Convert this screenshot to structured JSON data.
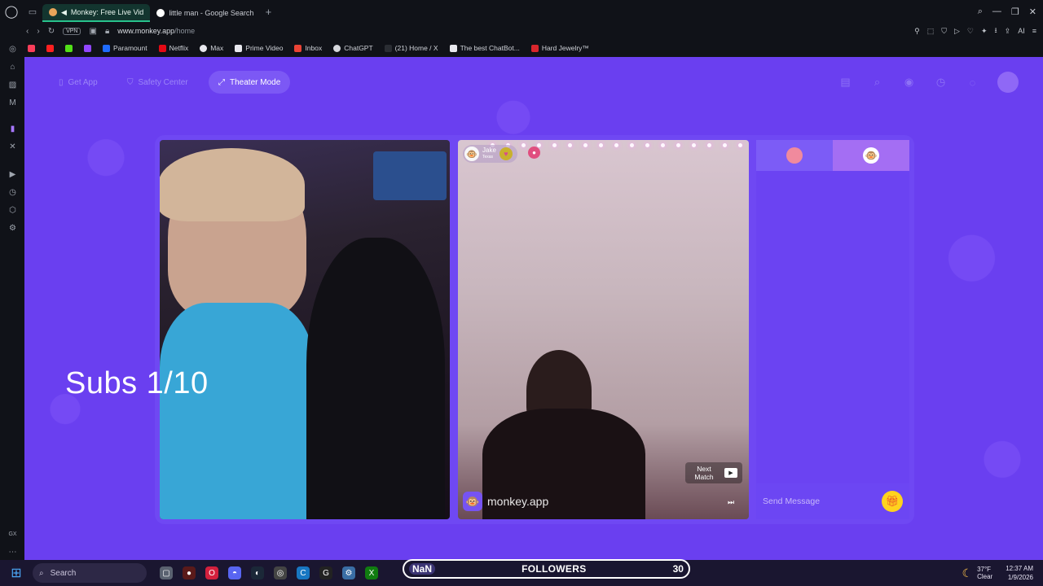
{
  "browser": {
    "tabs": [
      {
        "title": "Monkey: Free Live Vid",
        "active": true
      },
      {
        "title": "little man - Google Search",
        "active": false
      }
    ],
    "address": {
      "vpn": "VPN",
      "domain": "www.monkey.app",
      "path": "/home"
    },
    "bookmarks": [
      "Paramount",
      "Netflix",
      "Max",
      "Prime Video",
      "Inbox",
      "ChatGPT",
      "(21) Home / X",
      "The best ChatBot...",
      "Hard Jewelry™"
    ],
    "address_right_label": "AI"
  },
  "nav": {
    "get_app": "Get App",
    "safety_center": "Safety Center",
    "theater_mode": "Theater Mode"
  },
  "match": {
    "user_name": "Jake",
    "user_location": "Texas",
    "brand": "monkey.app",
    "next_match": "Next Match"
  },
  "chat": {
    "placeholder": "Send Message"
  },
  "overlay_text": "Subs 1/10",
  "taskbar": {
    "search": "Search",
    "overlay_left": "NaN",
    "overlay_mid": "FOLLOWERS",
    "overlay_right": "30",
    "weather_temp": "37°F",
    "weather_desc": "Clear",
    "time": "12:37 AM",
    "date": "1/9/2026"
  },
  "colors": {
    "page_bg": "#6a3ff0",
    "accent": "#7c58f5",
    "gift": "#ffd21e"
  }
}
